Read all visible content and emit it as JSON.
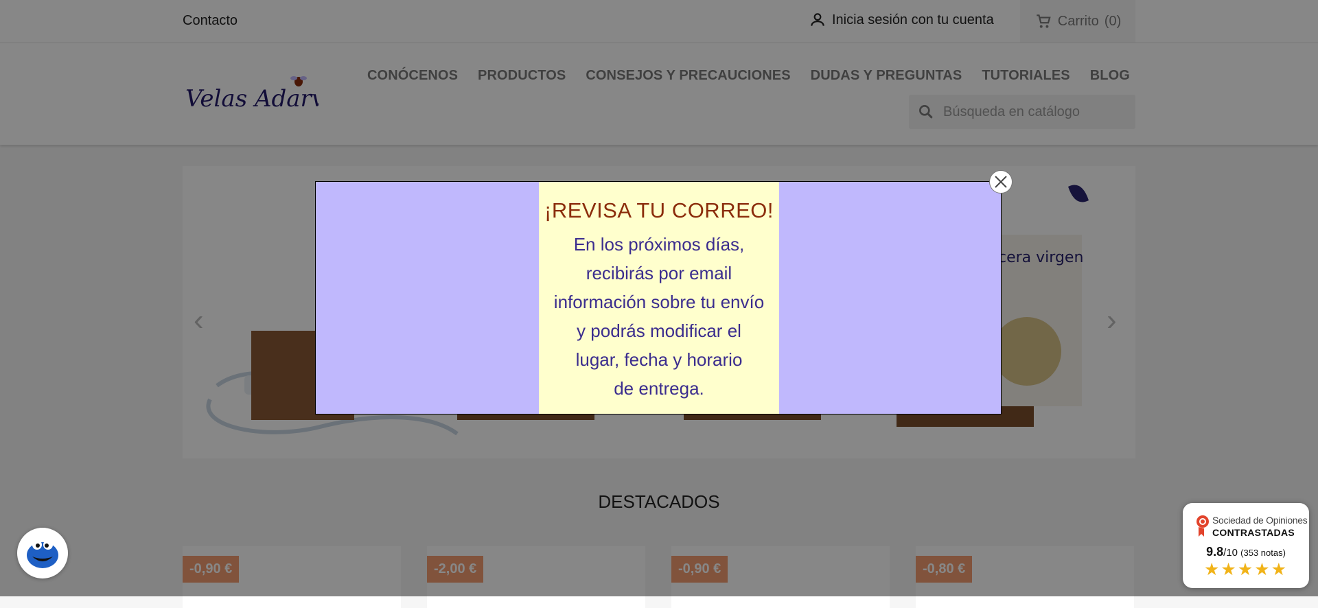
{
  "topbar": {
    "contact": "Contacto",
    "signin": "Inicia sesión con tu cuenta",
    "cart": "Carrito",
    "cart_count": "(0)"
  },
  "header": {
    "logo_text": "Velas Adarves",
    "nav": [
      "CONÓCENOS",
      "PRODUCTOS",
      "CONSEJOS Y PRECAUCIONES",
      "DUDAS Y PREGUNTAS",
      "TUTORIALES",
      "BLOG"
    ],
    "search_placeholder": "Búsqueda en catálogo"
  },
  "slider": {
    "image_text": "cera virgen"
  },
  "featured": {
    "title": "DESTACADOS",
    "badges": [
      "-0,90 €",
      "-2,00 €",
      "-0,90 €",
      "-0,80 €"
    ]
  },
  "modal": {
    "title": "¡REVISA TU CORREO!",
    "lines": [
      "En los próximos días,",
      "recibirás por email",
      "información sobre tu envío",
      "y podrás modificar el",
      "lugar, fecha y horario",
      "de entrega."
    ]
  },
  "reviews": {
    "line1": "Sociedad de Opiniones",
    "line2": "CONTRASTADAS",
    "score": "9.8",
    "scale": "/10",
    "count": "(353 notas)",
    "stars": "★★★★★",
    "star_color": "#f1b318"
  },
  "colors": {
    "badge": "#f39d72",
    "modal_bg": "#c0b8fd",
    "modal_panel": "#ffffcd",
    "modal_title": "#8b2d0c",
    "modal_text": "#3b2d8e"
  }
}
